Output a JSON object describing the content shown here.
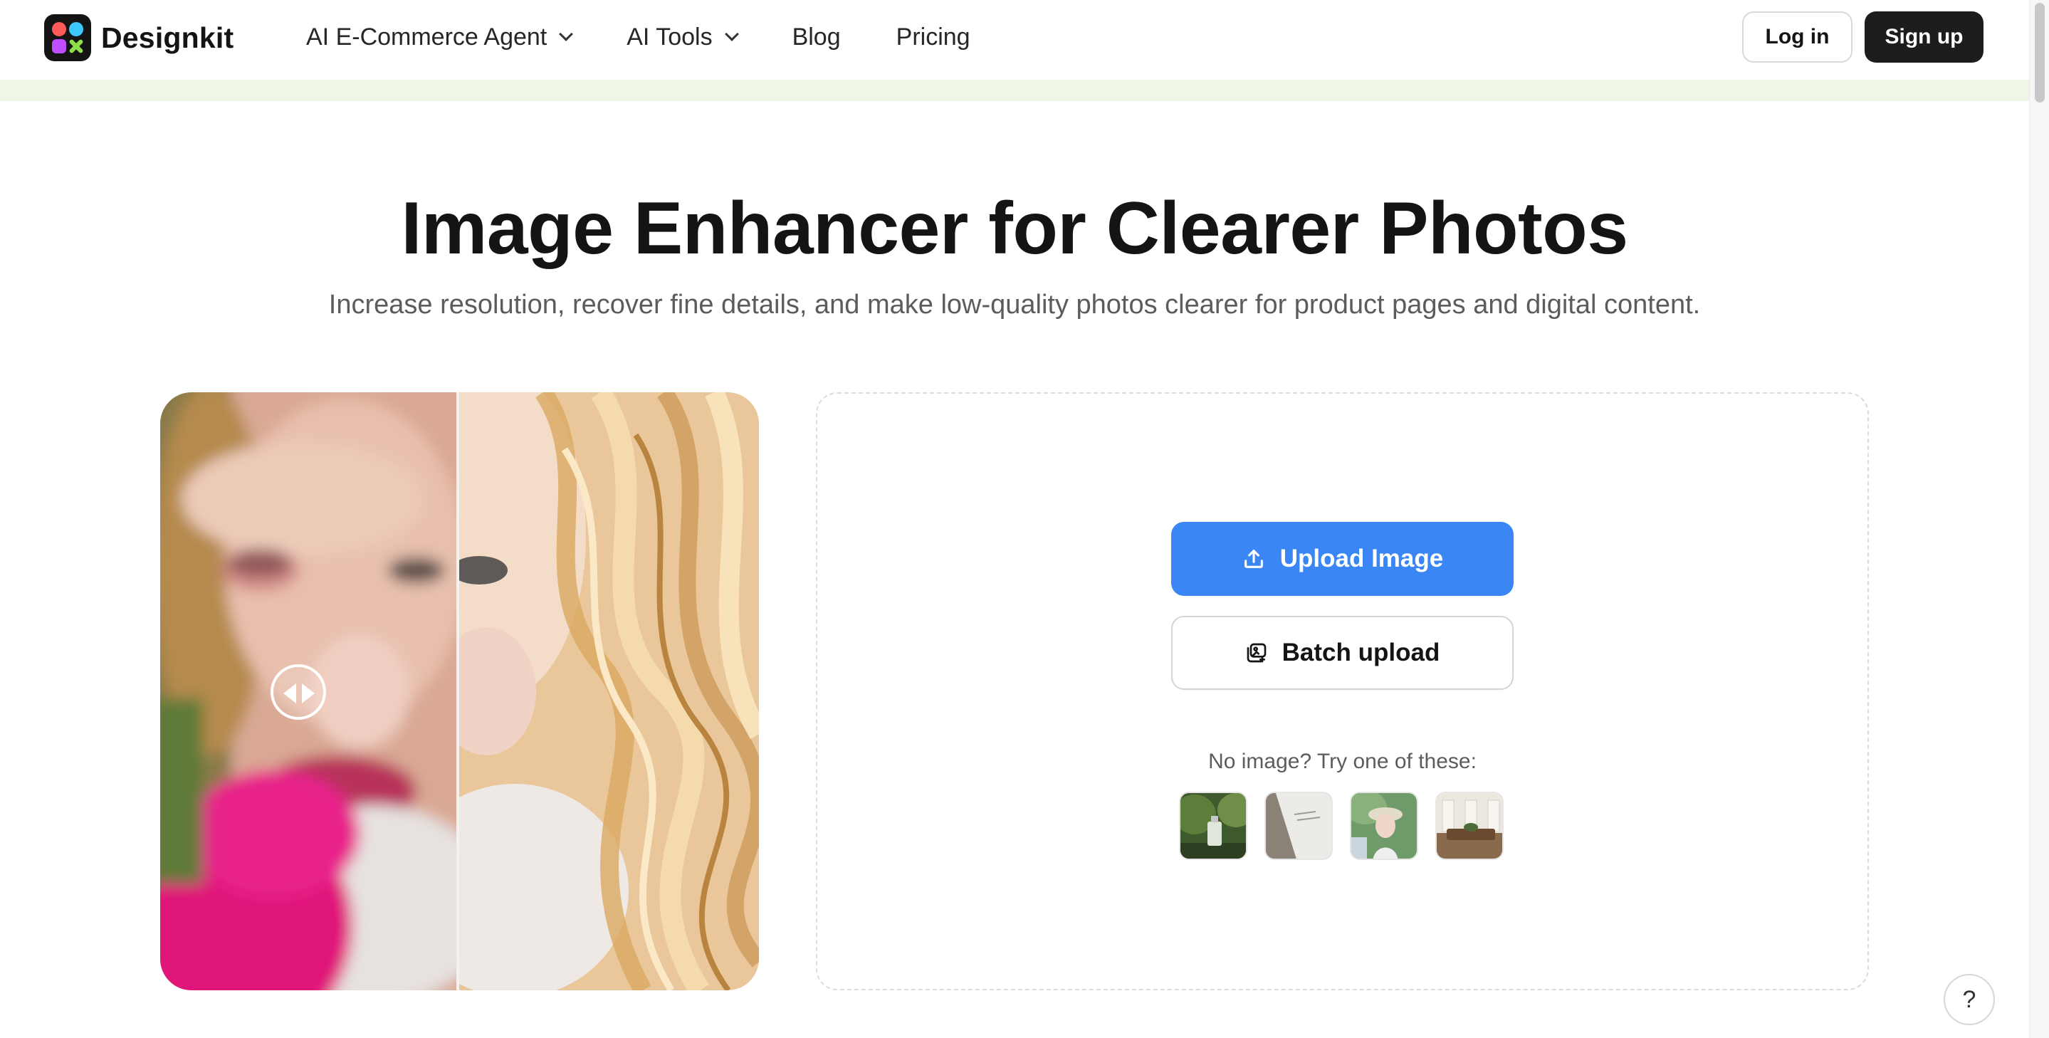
{
  "brand": {
    "name": "Designkit"
  },
  "nav": {
    "items": [
      {
        "label": "AI E-Commerce Agent",
        "has_dropdown": true
      },
      {
        "label": "AI Tools",
        "has_dropdown": true
      },
      {
        "label": "Blog",
        "has_dropdown": false
      },
      {
        "label": "Pricing",
        "has_dropdown": false
      }
    ],
    "login_label": "Log in",
    "signup_label": "Sign up"
  },
  "hero": {
    "title": "Image Enhancer for Clearer Photos",
    "subtitle": "Increase resolution, recover fine details, and make low-quality photos clearer for product pages and digital content."
  },
  "upload": {
    "upload_label": "Upload Image",
    "batch_label": "Batch upload",
    "try_text": "No image? Try one of these:",
    "samples": [
      "perfume-bottle-sample",
      "book-page-sample",
      "portrait-sample",
      "room-interior-sample"
    ]
  },
  "help": {
    "label": "?"
  },
  "colors": {
    "primary": "#3a86f5",
    "dark_button": "#1d1d1f",
    "banner": "#eef7e6"
  }
}
